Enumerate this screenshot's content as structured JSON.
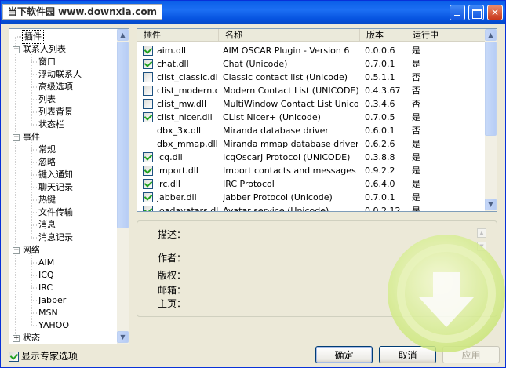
{
  "watermark_text": "当下软件园 www.downxia.com",
  "tree": {
    "items": [
      {
        "label": "插件",
        "level": 1,
        "expander": "none",
        "selected": true
      },
      {
        "label": "联系人列表",
        "level": 0,
        "expander": "minus"
      },
      {
        "label": "窗口",
        "level": 2,
        "expander": "none"
      },
      {
        "label": "浮动联系人",
        "level": 2,
        "expander": "none"
      },
      {
        "label": "高级选项",
        "level": 2,
        "expander": "none"
      },
      {
        "label": "列表",
        "level": 2,
        "expander": "none"
      },
      {
        "label": "列表背景",
        "level": 2,
        "expander": "none"
      },
      {
        "label": "状态栏",
        "level": 2,
        "expander": "none"
      },
      {
        "label": "事件",
        "level": 0,
        "expander": "minus"
      },
      {
        "label": "常规",
        "level": 2,
        "expander": "none"
      },
      {
        "label": "忽略",
        "level": 2,
        "expander": "none"
      },
      {
        "label": "键入通知",
        "level": 2,
        "expander": "none"
      },
      {
        "label": "聊天记录",
        "level": 2,
        "expander": "none"
      },
      {
        "label": "热键",
        "level": 2,
        "expander": "none"
      },
      {
        "label": "文件传输",
        "level": 2,
        "expander": "none"
      },
      {
        "label": "消息",
        "level": 2,
        "expander": "none"
      },
      {
        "label": "消息记录",
        "level": 2,
        "expander": "none"
      },
      {
        "label": "网络",
        "level": 0,
        "expander": "minus"
      },
      {
        "label": "AIM",
        "level": 2,
        "expander": "none"
      },
      {
        "label": "ICQ",
        "level": 2,
        "expander": "none"
      },
      {
        "label": "IRC",
        "level": 2,
        "expander": "none"
      },
      {
        "label": "Jabber",
        "level": 2,
        "expander": "none"
      },
      {
        "label": "MSN",
        "level": 2,
        "expander": "none"
      },
      {
        "label": "YAHOO",
        "level": 2,
        "expander": "none"
      },
      {
        "label": "状态",
        "level": 0,
        "expander": "plus"
      }
    ]
  },
  "plugins": {
    "columns": [
      "插件",
      "名称",
      "版本",
      "运行中"
    ],
    "rows": [
      {
        "checkbox": "checked",
        "file": "aim.dll",
        "name": "AIM OSCAR Plugin - Version 6",
        "version": "0.0.0.6",
        "running": "是"
      },
      {
        "checkbox": "checked",
        "file": "chat.dll",
        "name": "Chat (Unicode)",
        "version": "0.7.0.1",
        "running": "是"
      },
      {
        "checkbox": "unchecked",
        "file": "clist_classic.dll",
        "name": "Classic contact list (Unicode)",
        "version": "0.5.1.1",
        "running": "否"
      },
      {
        "checkbox": "unchecked",
        "file": "clist_modern.dll",
        "name": "Modern Contact List (UNICODE)",
        "version": "0.4.3.67",
        "running": "否"
      },
      {
        "checkbox": "unchecked",
        "file": "clist_mw.dll",
        "name": "MultiWindow Contact List Unicode",
        "version": "0.3.4.6",
        "running": "否"
      },
      {
        "checkbox": "checked",
        "file": "clist_nicer.dll",
        "name": "CList Nicer+ (Unicode)",
        "version": "0.7.0.5",
        "running": "是"
      },
      {
        "checkbox": "none",
        "file": "dbx_3x.dll",
        "name": "Miranda database driver",
        "version": "0.6.0.1",
        "running": "否"
      },
      {
        "checkbox": "none",
        "file": "dbx_mmap.dll",
        "name": "Miranda mmap database driver",
        "version": "0.6.2.6",
        "running": "是"
      },
      {
        "checkbox": "checked",
        "file": "icq.dll",
        "name": "IcqOscarJ Protocol (UNICODE)",
        "version": "0.3.8.8",
        "running": "是"
      },
      {
        "checkbox": "checked",
        "file": "import.dll",
        "name": "Import contacts and messages",
        "version": "0.9.2.2",
        "running": "是"
      },
      {
        "checkbox": "checked",
        "file": "irc.dll",
        "name": "IRC Protocol",
        "version": "0.6.4.0",
        "running": "是"
      },
      {
        "checkbox": "checked",
        "file": "jabber.dll",
        "name": "Jabber Protocol (Unicode)",
        "version": "0.7.0.1",
        "running": "是"
      },
      {
        "checkbox": "checked",
        "file": "loadavatars.dll",
        "name": "Avatar service (Unicode)",
        "version": "0.0.2.12",
        "running": "是"
      }
    ]
  },
  "info": {
    "description_label": "描述：",
    "author_label": "作者：",
    "copyright_label": "版权：",
    "email_label": "邮箱：",
    "homepage_label": "主页："
  },
  "footer": {
    "expert_label": "显示专家选项",
    "expert_checked": true,
    "ok_label": "确定",
    "cancel_label": "取消",
    "apply_label": "应用"
  },
  "colors": {
    "titlebar": "#0a5ee8",
    "checkmark": "#21a121",
    "watermark": "#d3eb8a"
  }
}
